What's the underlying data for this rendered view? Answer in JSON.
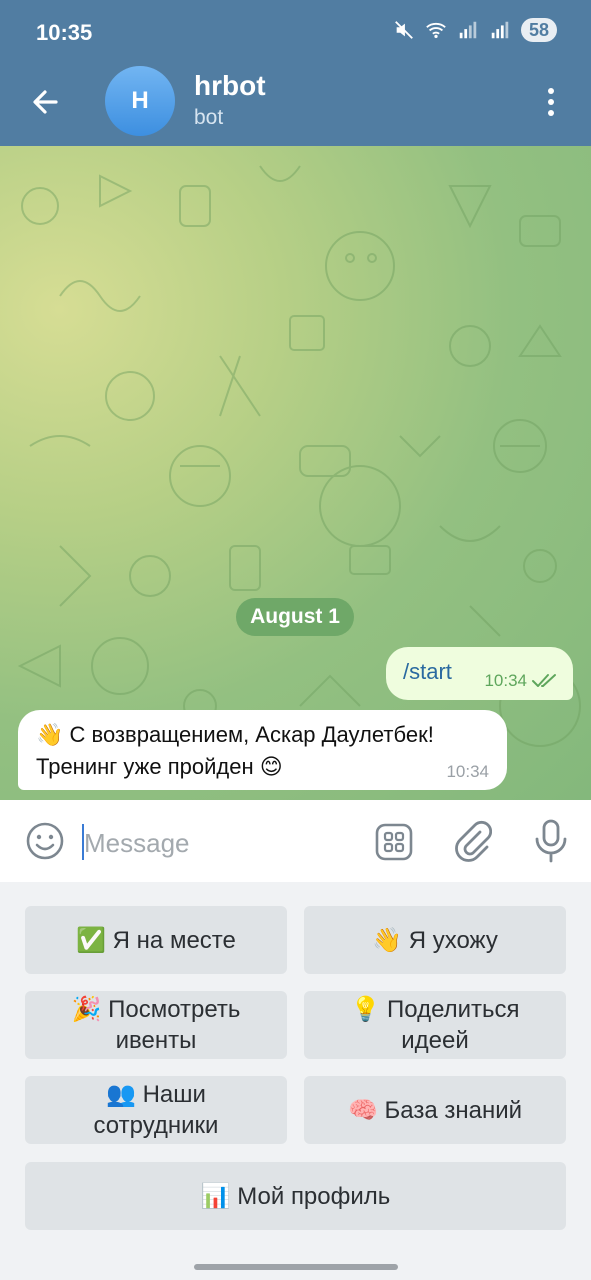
{
  "status_bar": {
    "time": "10:35",
    "battery": "58",
    "icons": [
      "mute-icon",
      "wifi-icon",
      "signal-icon",
      "signal-icon"
    ]
  },
  "header": {
    "avatar_letter": "H",
    "title": "hrbot",
    "subtitle": "bot",
    "icons": [
      "back-arrow-icon",
      "more-vertical-icon"
    ]
  },
  "chat": {
    "date": "August 1",
    "messages": [
      {
        "direction": "outgoing",
        "text": "/start",
        "time": "10:34",
        "status": "read"
      },
      {
        "direction": "incoming",
        "line1": "👋 С возвращением, Аскар Даулетбек!",
        "line2": "Тренинг уже пройден 😊",
        "time": "10:34"
      }
    ]
  },
  "composer": {
    "placeholder": "Message",
    "value": "",
    "icons": [
      "emoji-icon",
      "keyboard-icon",
      "attach-icon",
      "microphone-icon"
    ]
  },
  "bot_keyboard": {
    "buttons": [
      {
        "line1": "✅ Я на месте",
        "line2": ""
      },
      {
        "line1": "👋 Я ухожу",
        "line2": ""
      },
      {
        "line1": "🎉 Посмотреть",
        "line2": "ивенты"
      },
      {
        "line1": "💡 Поделиться",
        "line2": "идеей"
      },
      {
        "line1": "👥 Наши",
        "line2": "сотрудники"
      },
      {
        "line1": "🧠 База знаний",
        "line2": ""
      },
      {
        "line1": "📊 Мой профиль",
        "line2": ""
      }
    ]
  },
  "colors": {
    "header": "#517da2",
    "outgoing_bubble": "#effdde",
    "incoming_bubble": "#ffffff",
    "date_pill": "#6fa868",
    "keyboard_button": "#dfe3e6"
  }
}
